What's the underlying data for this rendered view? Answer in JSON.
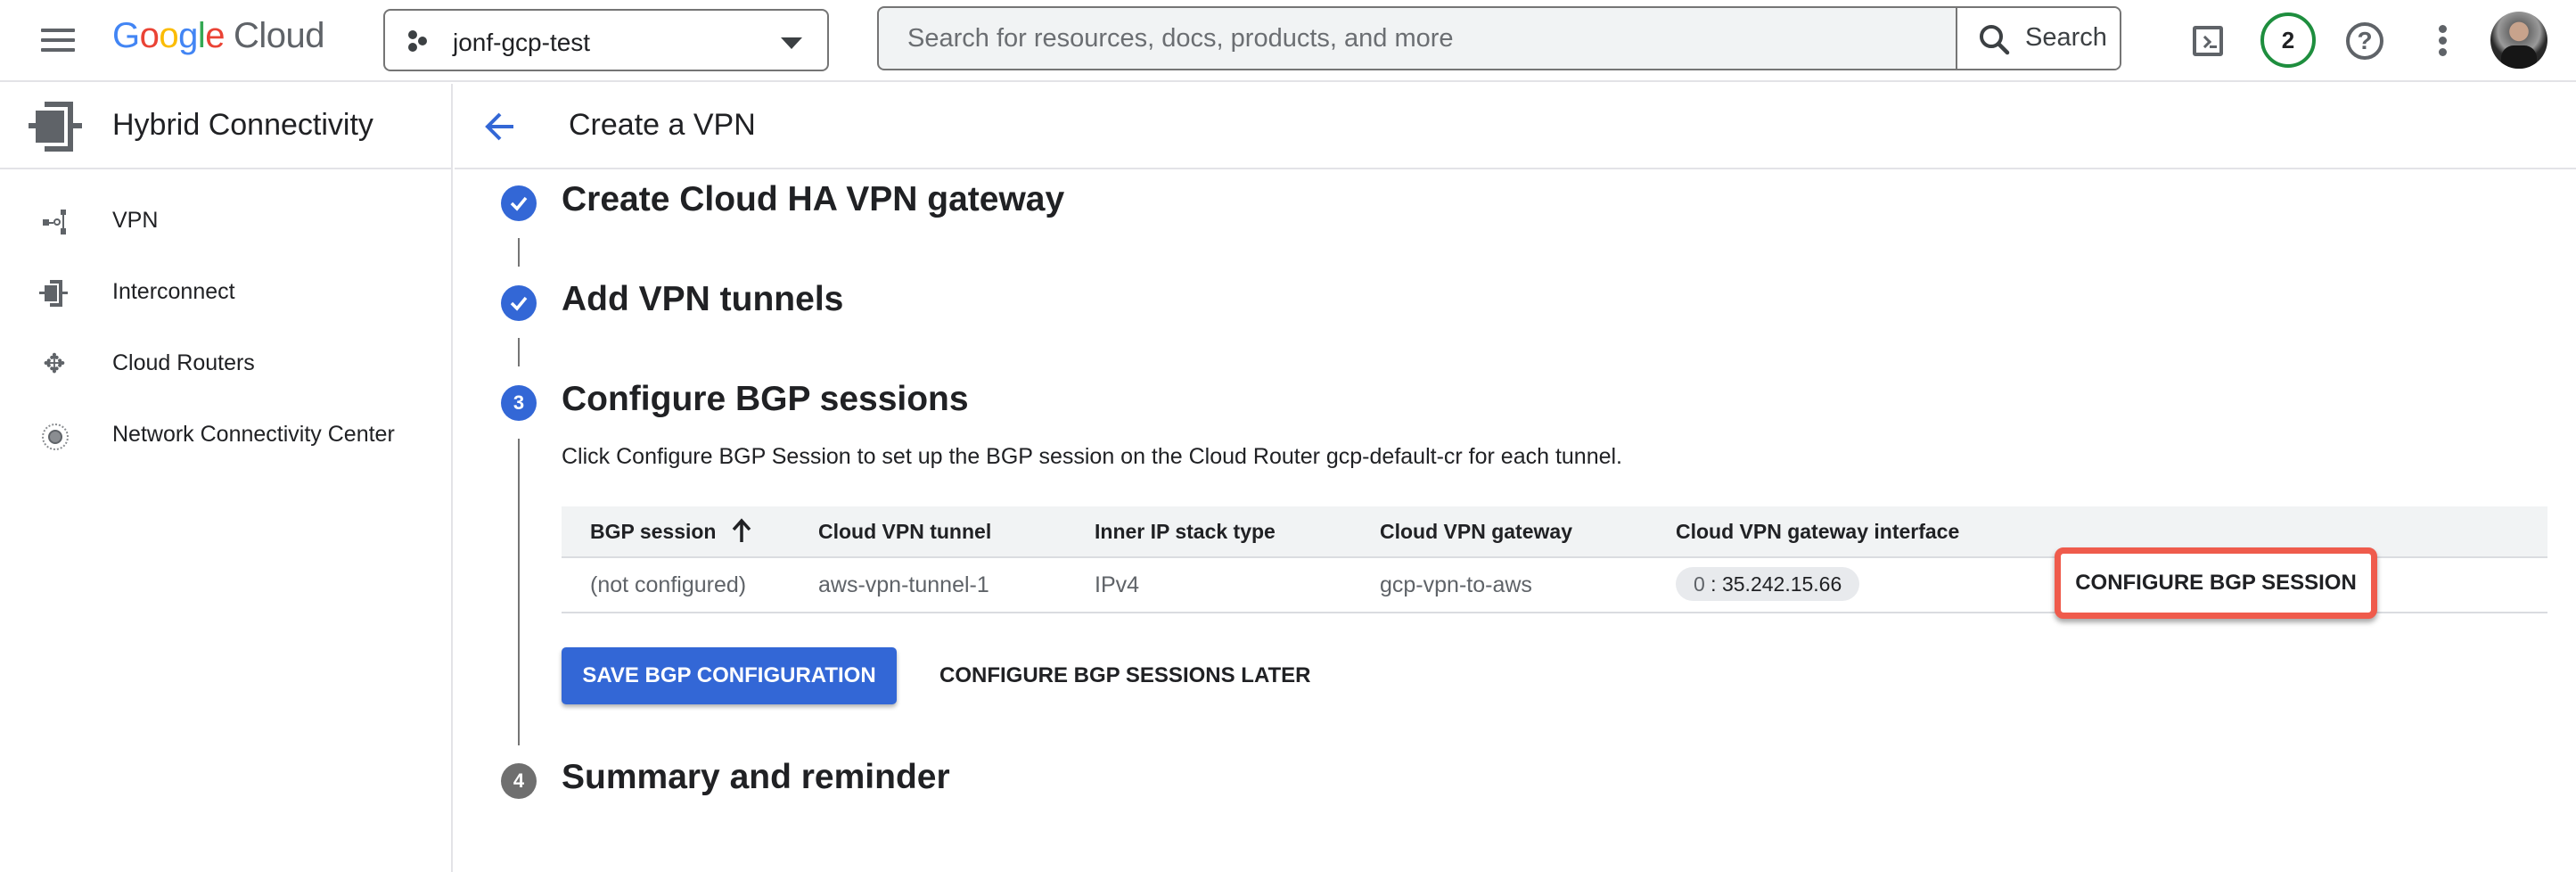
{
  "topbar": {
    "logo": {
      "google": "Google",
      "cloud": "Cloud"
    },
    "project": {
      "name": "jonf-gcp-test"
    },
    "search": {
      "placeholder": "Search for resources, docs, products, and more",
      "value": "",
      "button_label": "Search"
    },
    "notifications": {
      "count": "2"
    },
    "help": {
      "glyph": "?"
    },
    "icons": [
      "menu-icon",
      "project-icon",
      "search-icon",
      "cloud-shell-icon",
      "help-icon",
      "more-vert-icon",
      "avatar"
    ]
  },
  "sidebar": {
    "product_title": "Hybrid Connectivity",
    "items": [
      {
        "label": "VPN",
        "icon": "vpn-icon"
      },
      {
        "label": "Interconnect",
        "icon": "interconnect-icon"
      },
      {
        "label": "Cloud Routers",
        "icon": "cloud-router-icon"
      },
      {
        "label": "Network Connectivity Center",
        "icon": "network-connectivity-center-icon"
      }
    ]
  },
  "page": {
    "title": "Create a VPN",
    "steps": [
      {
        "number": "1",
        "title": "Create Cloud HA VPN gateway",
        "state": "complete"
      },
      {
        "number": "2",
        "title": "Add VPN tunnels",
        "state": "complete"
      },
      {
        "number": "3",
        "title": "Configure BGP sessions",
        "state": "active"
      },
      {
        "number": "4",
        "title": "Summary and reminder",
        "state": "pending"
      }
    ],
    "bgp_step": {
      "description": "Click Configure BGP Session to set up the BGP session on the Cloud Router gcp-default-cr for each tunnel.",
      "table": {
        "columns": [
          "BGP session",
          "Cloud VPN tunnel",
          "Inner IP stack type",
          "Cloud VPN gateway",
          "Cloud VPN gateway interface"
        ],
        "sort": {
          "column": "BGP session",
          "direction": "ascending"
        },
        "rows": [
          {
            "bgp_session": "(not configured)",
            "tunnel": "aws-vpn-tunnel-1",
            "stack_type": "IPv4",
            "gateway": "gcp-vpn-to-aws",
            "interface_index": "0",
            "interface_ip": "35.242.15.66",
            "action_label": "CONFIGURE BGP SESSION"
          }
        ]
      },
      "save_label": "SAVE BGP CONFIGURATION",
      "later_label": "CONFIGURE BGP SESSIONS LATER"
    }
  },
  "colors": {
    "primary": "#3367d6",
    "highlight": "#ef5b4c",
    "notification_ring": "#1e8e3e",
    "pending_step": "#6f6f6f"
  }
}
